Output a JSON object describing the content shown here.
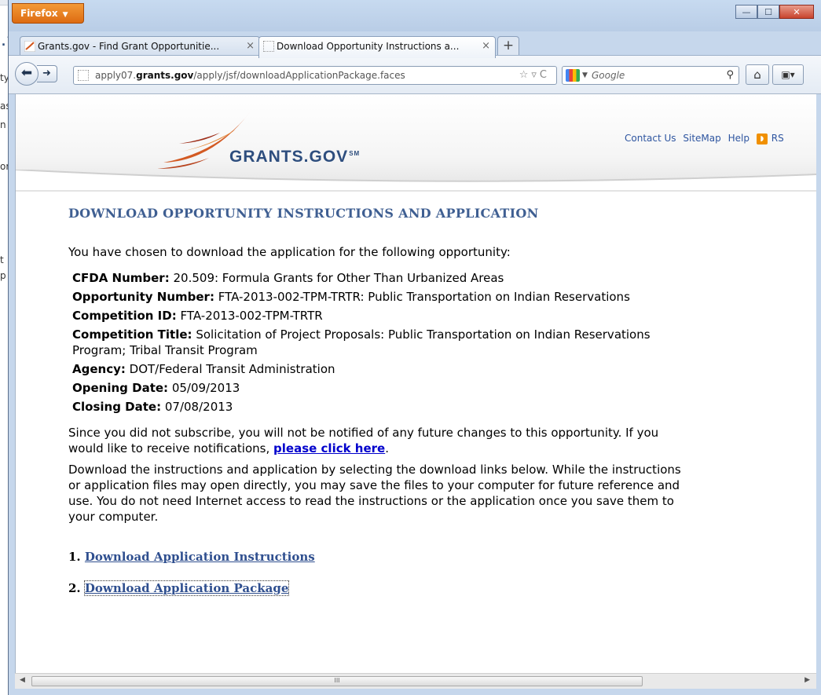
{
  "background_window": {
    "fragments": [
      "ty",
      "as",
      "n",
      "or",
      "t",
      "p"
    ],
    "title_fragment": ".l"
  },
  "browser": {
    "app_button": "Firefox",
    "tabs": [
      {
        "label": "Grants.gov - Find Grant Opportunitie...",
        "active": false
      },
      {
        "label": "Download Opportunity Instructions a...",
        "active": true
      }
    ],
    "url_prefix": "apply07.",
    "url_domain": "grants.gov",
    "url_path": "/apply/jsf/downloadApplicationPackage.faces",
    "search_placeholder": "Google",
    "window_controls": {
      "minimize": "—",
      "maximize": "☐",
      "close": "✕"
    }
  },
  "site": {
    "logo_text": "GRANTS.GOV",
    "logo_mark": "SM",
    "header_links": [
      "Contact Us",
      "SiteMap",
      "Help",
      "RS"
    ]
  },
  "page": {
    "title": "DOWNLOAD OPPORTUNITY INSTRUCTIONS AND APPLICATION",
    "intro": "You have chosen to download the application for the following opportunity:",
    "details": [
      {
        "label": "CFDA Number:",
        "value": "20.509: Formula Grants for Other Than Urbanized Areas"
      },
      {
        "label": "Opportunity Number:",
        "value": "FTA-2013-002-TPM-TRTR: Public Transportation on Indian Reservations"
      },
      {
        "label": "Competition ID:",
        "value": "FTA-2013-002-TPM-TRTR"
      },
      {
        "label": "Competition Title:",
        "value": "Solicitation of Project Proposals: Public Transportation on Indian Reservations",
        "value_line2": "Program; Tribal Transit Program"
      },
      {
        "label": "Agency:",
        "value": "DOT/Federal Transit Administration"
      },
      {
        "label": "Opening Date:",
        "value": "05/09/2013"
      },
      {
        "label": "Closing Date:",
        "value": "07/08/2013"
      }
    ],
    "subscribe_text_1": "Since you did not subscribe, you will not be notified of any future changes to this opportunity. If you",
    "subscribe_text_2": "would like to receive notifications,",
    "subscribe_link": "please click here",
    "subscribe_end": ".",
    "download_text": [
      "Download the instructions and application by selecting the download links below. While the instructions",
      "or application files may open directly, you may save the files to your computer for future reference and",
      "use. You do not need Internet access to read the instructions or the application once you save them to",
      "your computer."
    ],
    "links": [
      {
        "number": "1.",
        "label": "Download Application Instructions"
      },
      {
        "number": "2.",
        "label": "Download Application Package"
      }
    ]
  },
  "scrollbar": {
    "grip": "III"
  }
}
